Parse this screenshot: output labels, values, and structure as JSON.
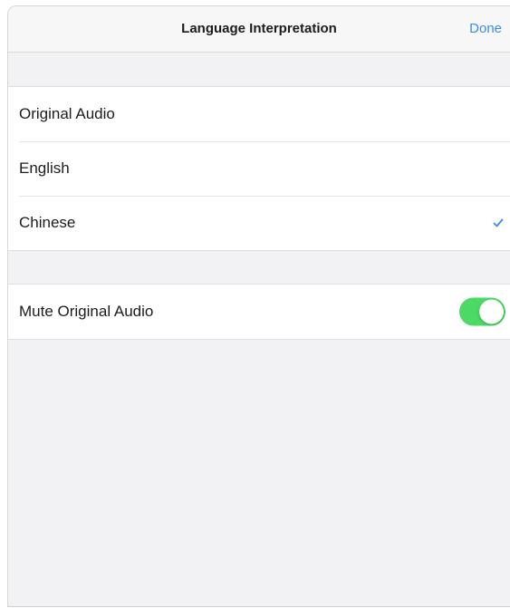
{
  "nav": {
    "title": "Language Interpretation",
    "done_label": "Done"
  },
  "languages": [
    {
      "label": "Original Audio",
      "selected": false
    },
    {
      "label": "English",
      "selected": false
    },
    {
      "label": "Chinese",
      "selected": true
    }
  ],
  "settings": {
    "mute_original_audio": {
      "label": "Mute Original Audio",
      "enabled": true
    }
  },
  "colors": {
    "accent": "#3a8ee6",
    "toggle_on": "#4cd964",
    "background": "#f2f2f4"
  },
  "icons": {
    "selected_marker": "checkmark-icon"
  }
}
